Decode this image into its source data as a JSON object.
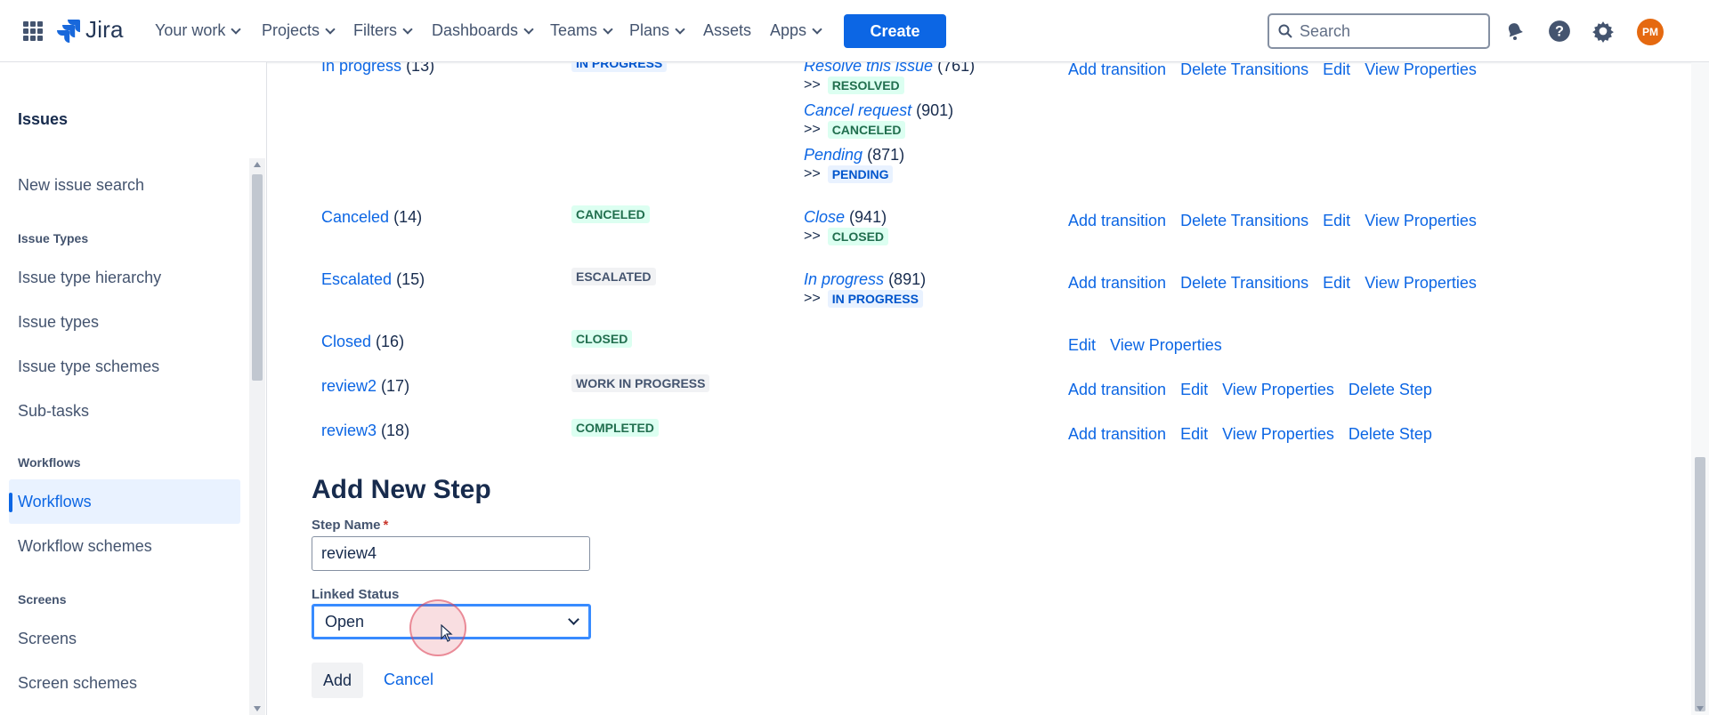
{
  "topnav": {
    "logo_text": "Jira",
    "items": [
      {
        "label": "Your work",
        "has_menu": true
      },
      {
        "label": "Projects",
        "has_menu": true
      },
      {
        "label": "Filters",
        "has_menu": true
      },
      {
        "label": "Dashboards",
        "has_menu": true
      },
      {
        "label": "Teams",
        "has_menu": true
      },
      {
        "label": "Plans",
        "has_menu": true
      },
      {
        "label": "Assets",
        "has_menu": false
      },
      {
        "label": "Apps",
        "has_menu": true
      }
    ],
    "create_label": "Create",
    "search_placeholder": "Search",
    "avatar_initials": "PM",
    "icons": [
      "app-switcher-icon",
      "notifications-icon",
      "help-icon",
      "settings-icon"
    ]
  },
  "sidebar": {
    "title": "Issues",
    "items": [
      {
        "type": "link",
        "label": "New issue search"
      },
      {
        "type": "heading",
        "label": "Issue Types"
      },
      {
        "type": "link",
        "label": "Issue type hierarchy"
      },
      {
        "type": "link",
        "label": "Issue types"
      },
      {
        "type": "link",
        "label": "Issue type schemes"
      },
      {
        "type": "link",
        "label": "Sub-tasks"
      },
      {
        "type": "heading",
        "label": "Workflows"
      },
      {
        "type": "link",
        "label": "Workflows",
        "active": true
      },
      {
        "type": "link",
        "label": "Workflow schemes"
      },
      {
        "type": "heading",
        "label": "Screens"
      },
      {
        "type": "link",
        "label": "Screens"
      },
      {
        "type": "link",
        "label": "Screen schemes"
      }
    ]
  },
  "steps": [
    {
      "name": "In progress",
      "id": "(13)",
      "status": "IN PROGRESS",
      "transitions": [
        {
          "name": "Resolve this issue",
          "id": "(761)",
          "target": "RESOLVED"
        },
        {
          "name": "Cancel request",
          "id": "(901)",
          "target": "CANCELED"
        },
        {
          "name": "Pending",
          "id": "(871)",
          "target": "PENDING"
        }
      ],
      "operations": [
        "Add transition",
        "Delete Transitions",
        "Edit",
        "View Properties"
      ]
    },
    {
      "name": "Canceled",
      "id": "(14)",
      "status": "CANCELED",
      "transitions": [
        {
          "name": "Close",
          "id": "(941)",
          "target": "CLOSED"
        }
      ],
      "operations": [
        "Add transition",
        "Delete Transitions",
        "Edit",
        "View Properties"
      ]
    },
    {
      "name": "Escalated",
      "id": "(15)",
      "status": "ESCALATED",
      "transitions": [
        {
          "name": "In progress",
          "id": "(891)",
          "target": "IN PROGRESS"
        }
      ],
      "operations": [
        "Add transition",
        "Delete Transitions",
        "Edit",
        "View Properties"
      ]
    },
    {
      "name": "Closed",
      "id": "(16)",
      "status": "CLOSED",
      "transitions": [],
      "operations": [
        "Edit",
        "View Properties"
      ]
    },
    {
      "name": "review2",
      "id": "(17)",
      "status": "WORK IN PROGRESS",
      "transitions": [],
      "operations": [
        "Add transition",
        "Edit",
        "View Properties",
        "Delete Step"
      ]
    },
    {
      "name": "review3",
      "id": "(18)",
      "status": "COMPLETED",
      "transitions": [],
      "operations": [
        "Add transition",
        "Edit",
        "View Properties",
        "Delete Step"
      ]
    }
  ],
  "arrow_prefix": ">>",
  "add_step": {
    "title": "Add New Step",
    "step_name_label": "Step Name",
    "required_marker": "*",
    "step_name_value": "review4",
    "linked_status_label": "Linked Status",
    "linked_status_value": "Open",
    "add_label": "Add",
    "cancel_label": "Cancel"
  },
  "colors": {
    "accent": "#0c66e4",
    "lozenge_blue_bg": "#e9f2ff",
    "lozenge_green_bg": "#dcfff1",
    "lozenge_grey_bg": "#f1f2f4"
  }
}
